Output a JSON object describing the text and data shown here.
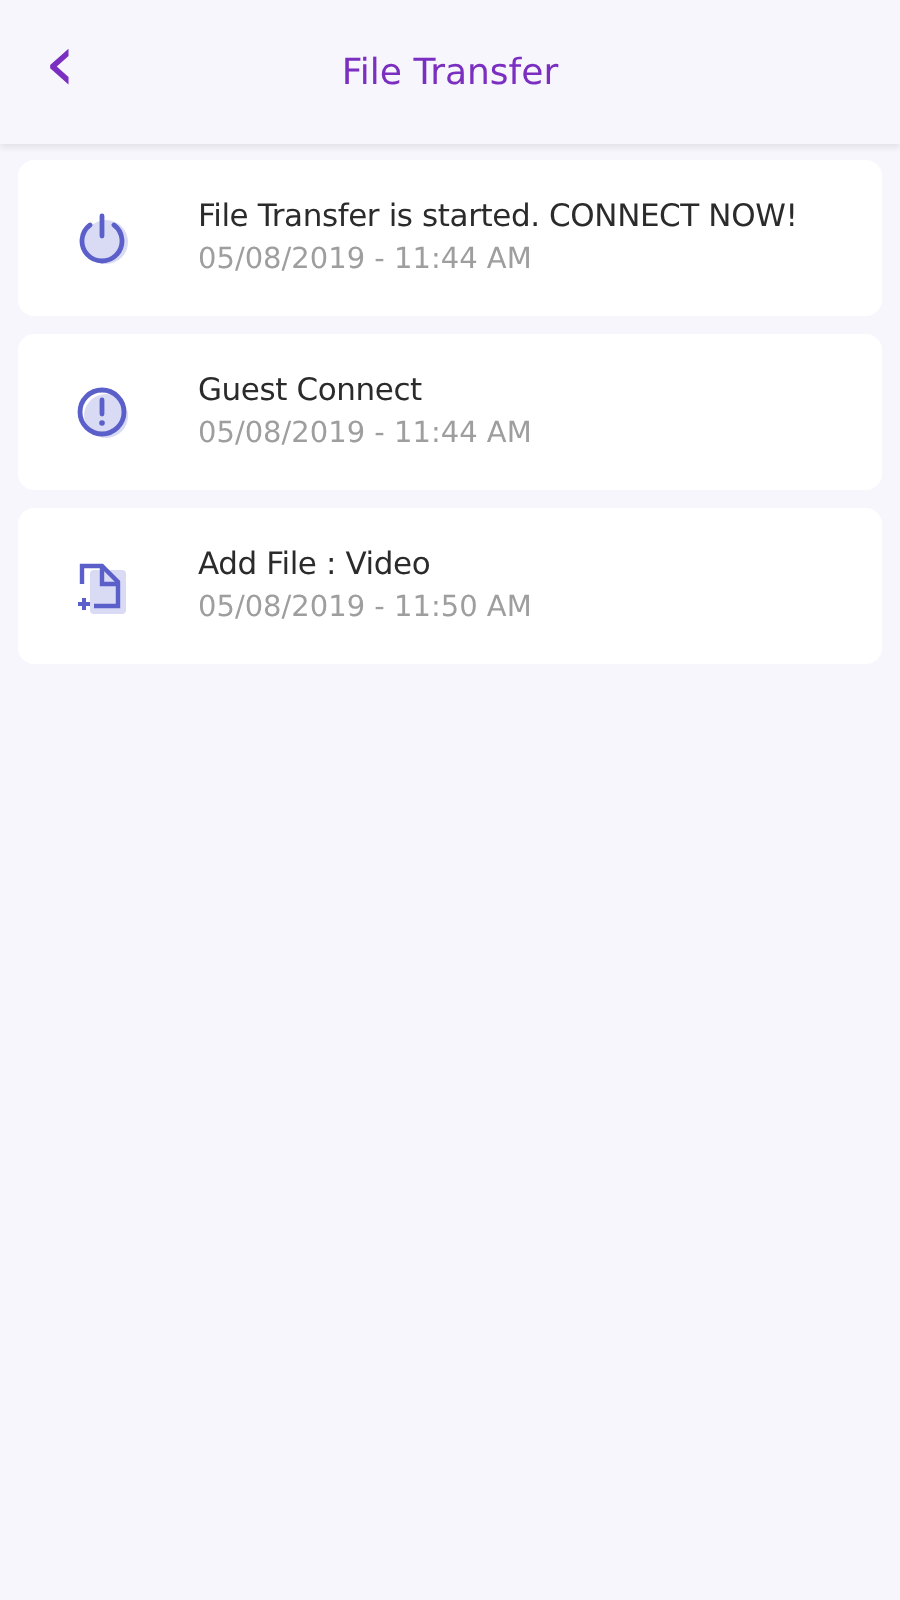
{
  "header": {
    "back_icon": "‹",
    "title": "File Transfer"
  },
  "notifications": [
    {
      "kind": "power",
      "title": "File Transfer is started. CONNECT NOW!",
      "time": "05/08/2019 - 11:44 AM"
    },
    {
      "kind": "alert",
      "title": "Guest Connect",
      "time": "05/08/2019 - 11:44 AM"
    },
    {
      "kind": "file-add",
      "title": "Add File : Video",
      "time": "05/08/2019 - 11:50 AM"
    }
  ]
}
